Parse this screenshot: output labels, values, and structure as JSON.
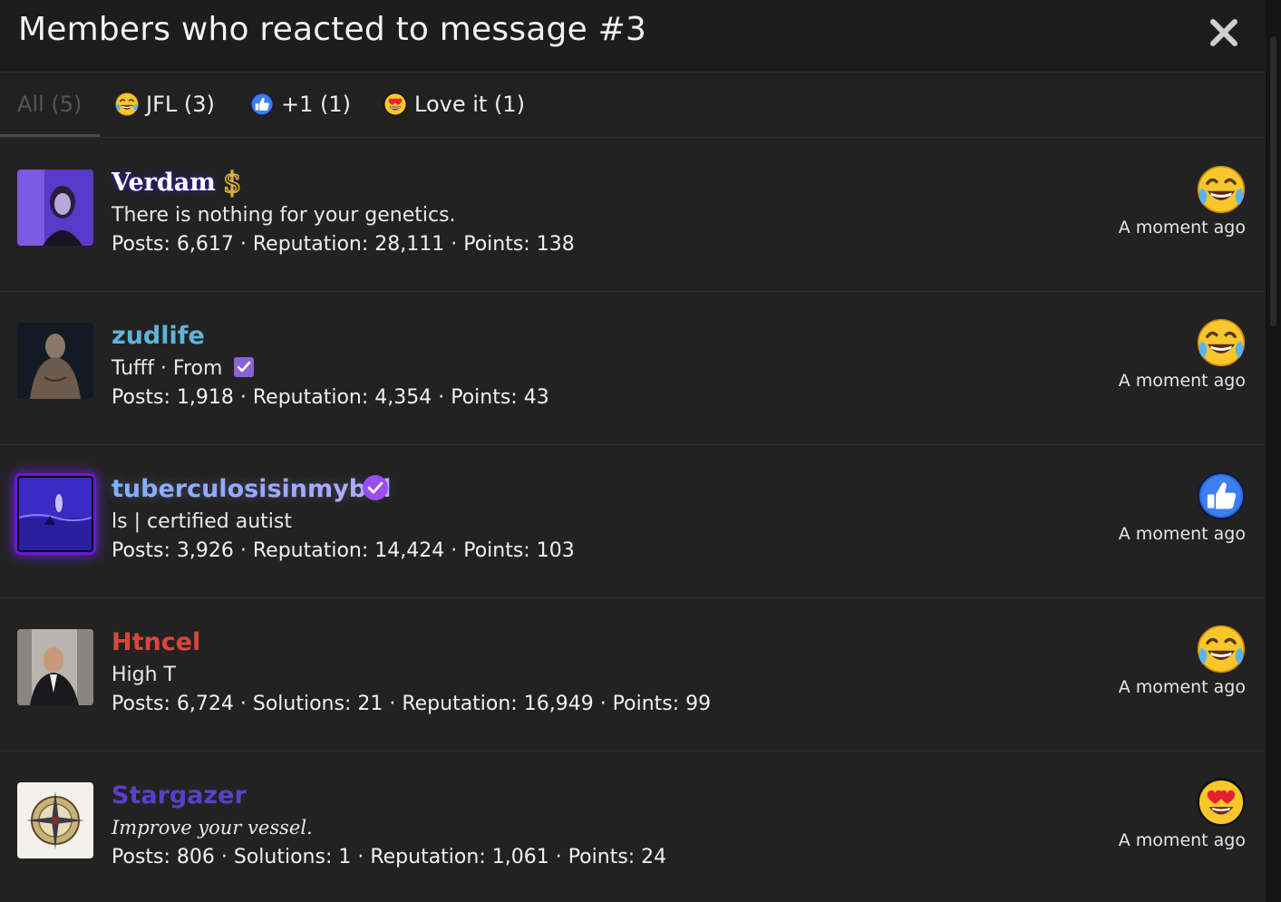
{
  "dialog": {
    "title": "Members who reacted to message #3"
  },
  "tabs": [
    {
      "label": "All (5)",
      "icon": null,
      "active": true
    },
    {
      "label": "JFL (3)",
      "icon": "laugh-cry-icon",
      "active": false
    },
    {
      "label": "+1 (1)",
      "icon": "thumbs-up-icon",
      "active": false
    },
    {
      "label": "Love it (1)",
      "icon": "heart-eyes-icon",
      "active": false
    }
  ],
  "members": [
    {
      "name": "Verdam",
      "name_color": "#ffffff",
      "title": "There is nothing for your genetics.",
      "stats": "Posts: 6,617 · Reputation: 28,111 · Points: 138",
      "reaction": "laugh-cry-icon",
      "time": "A moment ago",
      "badge": "dollar-icon"
    },
    {
      "name": "zudlife",
      "name_color": "#5fb3da",
      "title": "Tufff · From",
      "stats": "Posts: 1,918 · Reputation: 4,354 · Points: 43",
      "reaction": "laugh-cry-icon",
      "time": "A moment ago",
      "badge": "checkbox-icon"
    },
    {
      "name": "tuberculosisinmybal",
      "name_color": "#8ab4f8",
      "title": "ls | certified autist",
      "stats": "Posts: 3,926 · Reputation: 14,424 · Points: 103",
      "reaction": "thumbs-up-icon",
      "time": "A moment ago",
      "badge": "verified-icon"
    },
    {
      "name": "Htncel",
      "name_color": "#d9473a",
      "title": "High T",
      "stats": "Posts: 6,724 · Solutions: 21 · Reputation: 16,949 · Points: 99",
      "reaction": "laugh-cry-icon",
      "time": "A moment ago",
      "badge": null
    },
    {
      "name": "Stargazer",
      "name_color": "#5b3fc8",
      "title": "Improve your vessel.",
      "stats": "Posts: 806 · Solutions: 1 · Reputation: 1,061 · Points: 24",
      "reaction": "heart-eyes-icon",
      "time": "A moment ago",
      "badge": null
    }
  ]
}
